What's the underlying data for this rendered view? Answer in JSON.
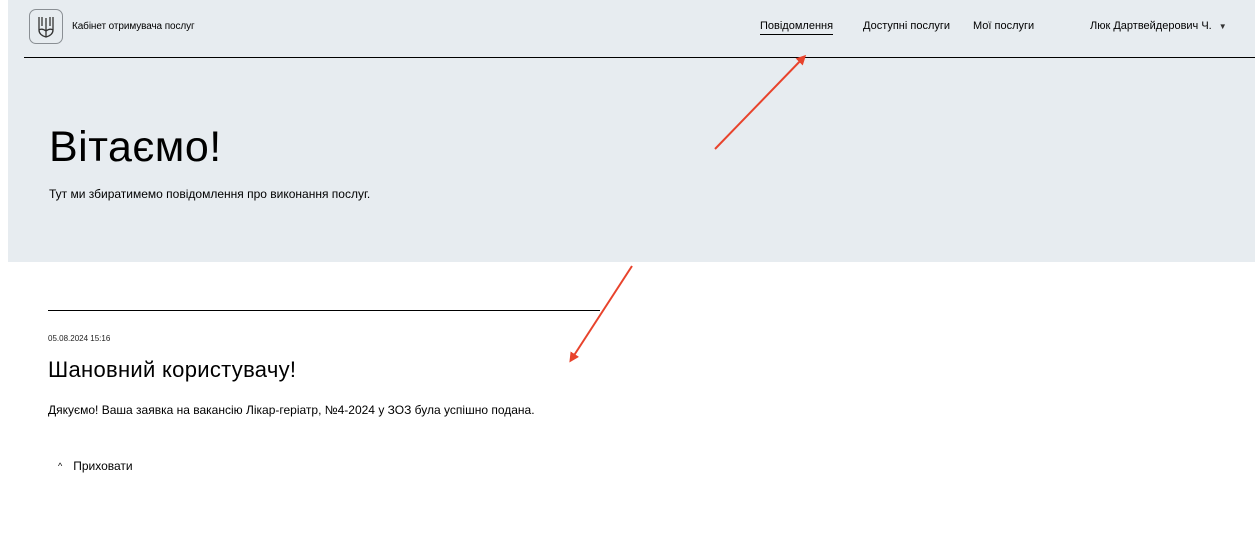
{
  "header": {
    "app_title": "Кабінет отримувача послуг",
    "nav": [
      {
        "label": "Повідомлення",
        "active": true
      },
      {
        "label": "Доступні послуги",
        "active": false
      },
      {
        "label": "Мої послуги",
        "active": false
      }
    ],
    "user_name": "Люк Дартвейдерович Ч.",
    "user_caret_icon": "caret-down-icon",
    "logo_icon": "trident-emblem-icon"
  },
  "hero": {
    "title": "Вітаємо!",
    "subtitle": "Тут ми збиратимемо повідомлення про виконання послуг."
  },
  "message": {
    "date": "05.08.2024 15:16",
    "title": "Шановний користувачу!",
    "body": "Дякуємо! Ваша заявка на вакансію Лікар-геріатр, №4-2024 у ЗОЗ була успішно подана.",
    "toggle_label": "Приховати",
    "toggle_icon": "chevron-up-icon"
  },
  "annotations": {
    "arrow_color": "#e8432c"
  },
  "colors": {
    "hero_background": "#e7ecf0"
  }
}
